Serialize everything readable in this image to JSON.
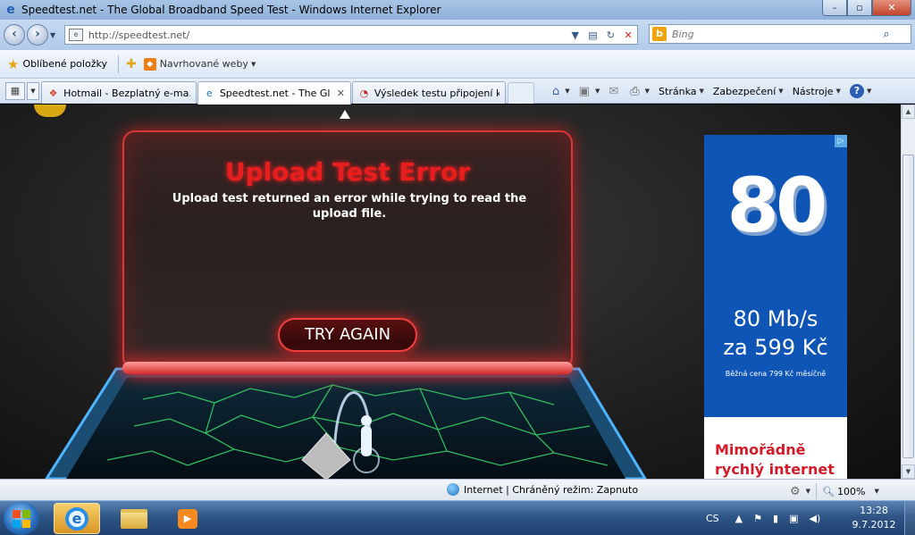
{
  "window": {
    "title": "Speedtest.net - The Global Broadband Speed Test - Windows Internet Explorer",
    "minimize": "–",
    "maximize": "▫",
    "close": "✕"
  },
  "addressbar": {
    "url": "http://speedtest.net/",
    "search_placeholder": "Bing",
    "search_engine_icon": "b"
  },
  "favorites_bar": {
    "favorites_label": "Oblíbené položky",
    "suggested_label": "Navrhované weby"
  },
  "tabs": [
    {
      "label": "Hotmail - Bezplatný e-ma...",
      "icon": "windows-icon",
      "active": false
    },
    {
      "label": "Speedtest.net - The Gl...",
      "icon": "ie-page-icon",
      "active": true
    },
    {
      "label": "Výsledek testu připojení k...",
      "icon": "loading-icon",
      "active": false
    }
  ],
  "commandbar": {
    "page": "Stránka",
    "safety": "Zabezpečení",
    "tools": "Nástroje"
  },
  "speedtest": {
    "error_title": "Upload Test Error",
    "error_message": "Upload test returned an error while trying to read the upload file.",
    "try_again": "TRY AGAIN"
  },
  "advertisement": {
    "big_number": "80",
    "speed": "80 Mb/s",
    "price": "za 599 Kč",
    "small_print": "Běžná cena 799 Kč měsíčně",
    "headline": "Mimořádně rychlý internet",
    "choice_icon": "▷"
  },
  "statusbar": {
    "zone": "Internet | Chráněný režim: Zapnuto",
    "zoom": "100%"
  },
  "taskbar": {
    "language": "CS",
    "time": "13:28",
    "date": "9.7.2012"
  },
  "colors": {
    "error_red": "#e81e1e",
    "ad_blue": "#0e55b5",
    "ad_headline_red": "#d11a2a",
    "map_glow": "#3ad86a"
  }
}
